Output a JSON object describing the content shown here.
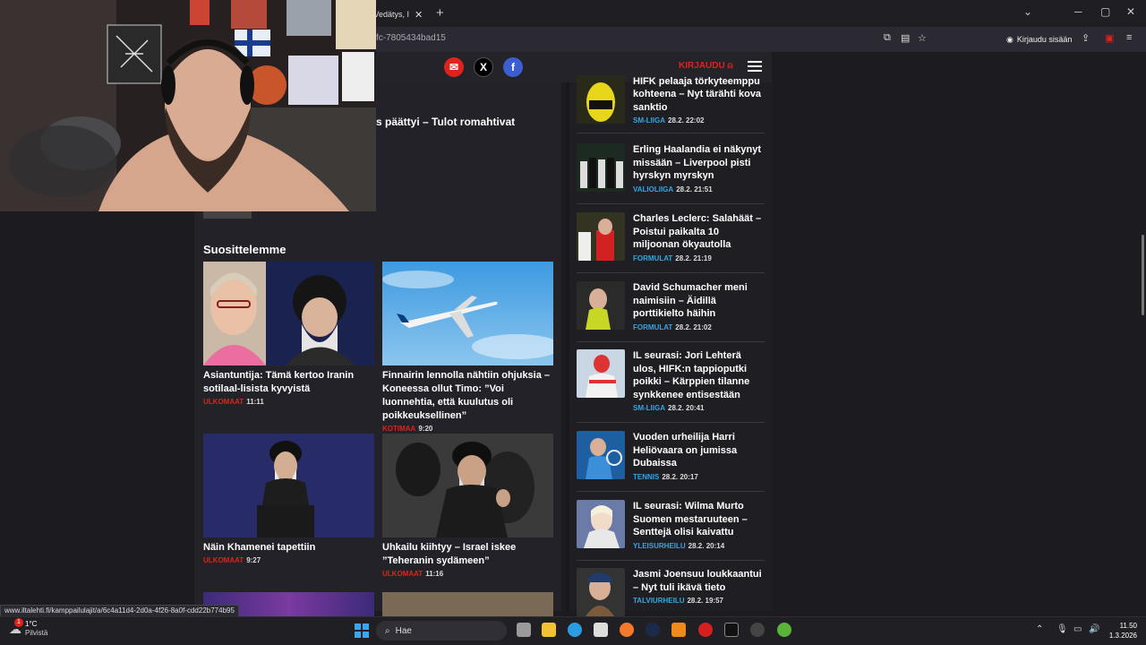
{
  "browser": {
    "tab_title": "a Vedätys, I",
    "tab_close": "✕",
    "new_tab": "+",
    "url": "fc-7805434bad15",
    "sign_in": "Kirjaudu sisään",
    "win_min": "─",
    "win_max": "▢",
    "win_close": "✕"
  },
  "site": {
    "login_label": "KIRJAUDU",
    "partial_headline": "s päättyi – Tulot romahtivat",
    "section_title": "Suosittelemme",
    "share_x": "X",
    "share_fb": "f",
    "share_mail": "✉"
  },
  "cards": [
    {
      "title": "Asiantuntija: Tämä kertoo Iranin sotilaal-lisista kyvyistä",
      "category": "ULKOMAAT",
      "time": "11:11"
    },
    {
      "title": "Finnairin lennolla nähtiin ohjuksia – Koneessa ollut Timo: ”Voi luonnehtia, että kuulutus oli poikkeuksellinen”",
      "category": "KOTIMAA",
      "time": "9:20"
    },
    {
      "title": "Näin Khamenei tapettiin",
      "category": "ULKOMAAT",
      "time": "9:27"
    },
    {
      "title": "Uhkailu kiihtyy – Israel iskee ”Teheranin sydämeen”",
      "category": "ULKOMAAT",
      "time": "11:16"
    }
  ],
  "sidebar": [
    {
      "title": "HIFK pelaaja törkyteemppu kohteena – Nyt tärähti kova sanktio",
      "category": "SM-LIIGA",
      "time": "28.2. 22:02"
    },
    {
      "title": "Erling Haalandia ei näkynyt missään – Liverpool pisti hyrskyn myrskyn",
      "category": "VALIOLIIGA",
      "time": "28.2. 21:51"
    },
    {
      "title": "Charles Leclerc: Salahäät – Poistui paikalta 10 miljoonan ökyautolla",
      "category": "FORMULAT",
      "time": "28.2. 21:19"
    },
    {
      "title": "David Schumacher meni naimisiin – Äidillä porttikielto häihin",
      "category": "FORMULAT",
      "time": "28.2. 21:02"
    },
    {
      "title": "IL seurasi: Jori Lehterä ulos, HIFK:n tappioputki poikki – Kärppien tilanne synkkenee entisestään",
      "category": "SM-LIIGA",
      "time": "28.2. 20:41"
    },
    {
      "title": "Vuoden urheilija Harri Heliövaara on jumissa Dubaissa",
      "category": "TENNIS",
      "time": "28.2. 20:17"
    },
    {
      "title": "IL seurasi: Wilma Murto Suomen mestaruuteen – Senttejä olisi kaivattu",
      "category": "YLEISURHEILU",
      "time": "28.2. 20:14"
    },
    {
      "title": "Jasmi Joensuu loukkaantui – Nyt tuli ikävä tieto",
      "category": "TALVIURHEILU",
      "time": "28.2. 19:57"
    }
  ],
  "status_url": "www.iltalehti.fi/kamppailulajit/a/6c4a11d4-2d0a-4f26-8a0f-cdd22b774b95",
  "taskbar": {
    "temp": "1°C",
    "weather_desc": "Pilvistä",
    "search_placeholder": "Hae",
    "time": "11.50",
    "date": "1.3.2026",
    "weather_badge": "1"
  },
  "colors": {
    "accent_red": "#e0221c",
    "sport_blue": "#35a6e0",
    "page_bg": "#1c1b1f"
  }
}
